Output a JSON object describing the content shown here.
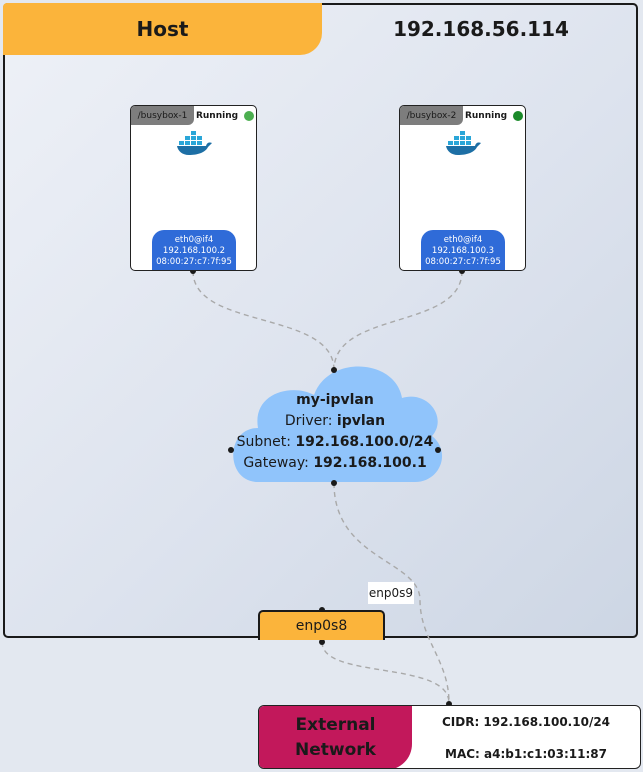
{
  "host": {
    "label": "Host",
    "ip": "192.168.56.114"
  },
  "containers": [
    {
      "name": "/busybox-1",
      "status": "Running",
      "status_color": "#4caf50",
      "iface_name": "eth0@if4",
      "iface_ip": "192.168.100.2",
      "iface_mac": "08:00:27:c7:7f:95"
    },
    {
      "name": "/busybox-2",
      "status": "Running",
      "status_color": "#1b8a2a",
      "iface_name": "eth0@if4",
      "iface_ip": "192.168.100.3",
      "iface_mac": "08:00:27:c7:7f:95"
    }
  ],
  "network": {
    "name": "my-ipvlan",
    "driver_label": "Driver:",
    "driver": "ipvlan",
    "subnet_label": "Subnet:",
    "subnet": "192.168.100.0/24",
    "gateway_label": "Gateway:",
    "gateway": "192.168.100.1"
  },
  "interfaces": {
    "host_iface": "enp0s8",
    "parent_iface": "enp0s9"
  },
  "external": {
    "label_line1": "External",
    "label_line2": "Network",
    "cidr": "CIDR: 192.168.100.10/24",
    "mac": "MAC: a4:b1:c1:03:11:87"
  },
  "colors": {
    "host_accent": "#fbb43b",
    "iface_blue": "#2f6bd8",
    "cloud_blue": "#90c4fb",
    "external_accent": "#c2185b"
  },
  "icons": {
    "container_icon": "docker-whale-icon"
  }
}
